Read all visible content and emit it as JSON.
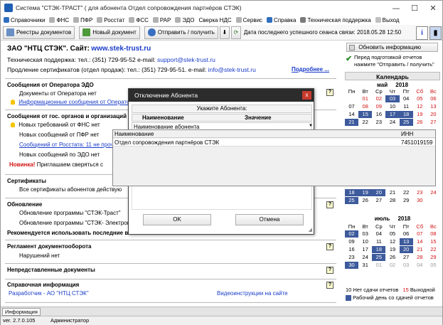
{
  "window": {
    "title": "Система \"СТЭК-ТРАСТ\" ( для абонента Отдел сопровождения партнёров СТЭК)",
    "minimize": "—",
    "maximize": "☐",
    "close": "✕"
  },
  "menu": [
    {
      "label": "Справочники",
      "icon": "book-icon",
      "color": "#2f6fc0"
    },
    {
      "label": "ФНС",
      "icon": "fns-icon",
      "color": "#b0b0b0"
    },
    {
      "label": "ПФР",
      "icon": "pfr-icon",
      "color": "#b0b0b0"
    },
    {
      "label": "Росстат",
      "icon": "rosstat-icon",
      "color": "#b0b0b0"
    },
    {
      "label": "ФСС",
      "icon": "fss-icon",
      "color": "#b0b0b0"
    },
    {
      "label": "РАР",
      "icon": "rar-icon",
      "color": "#b0b0b0"
    },
    {
      "label": "ЭДО",
      "icon": "edo-icon",
      "color": "#b0b0b0"
    },
    {
      "label": "Сверка НДС",
      "icon": "",
      "color": ""
    },
    {
      "label": "Сервис",
      "icon": "service-icon",
      "color": "#b0b0b0"
    },
    {
      "label": "Справка",
      "icon": "help-book-icon",
      "color": "#2f6fc0"
    },
    {
      "label": "Техническая поддержка",
      "icon": "support-icon",
      "color": "#7a7a7a"
    },
    {
      "label": "Выход",
      "icon": "exit-icon",
      "color": "#c0c0c0"
    }
  ],
  "toolbar": {
    "registry": "Реестры документов",
    "new_doc": "Новый документ",
    "send": "Отправить / получить",
    "last_session_label": "Дата последнего успешного сеанса связи:",
    "last_session_value": "2018.05.28 12:50"
  },
  "header": {
    "company": "ЗАО \"НТЦ СТЭК\". Сайт:",
    "site": "www.stek-trust.ru",
    "support_label": "Техническая поддержка: тел.: (351) 729-95-52 e-mail:",
    "support_email": "support@stek-trust.ru",
    "sales_label": "Продление сертификатов (отдел продаж): тел.: (351) 729-95-51. e-mail:",
    "sales_email": "info@stek-trust.ru",
    "more": "Подробнее ..."
  },
  "sections": {
    "edo_title": "Сообщения от Оператора ЭДО",
    "edo_docs": "Документы от Оператора нет",
    "edo_info": "Информационные сообщения от Оператора: 1",
    "gov_title": "Сообщения от гос. органов и организаций",
    "fns": "Новых требований от ФНС нет",
    "pfr": "Новых сообщений от ПФР нет",
    "rosstat": "Сообщений от Росстата: 11 не прочитан",
    "edo": "Новых сообщений по ЭДО нет",
    "news_label": "Новинка!",
    "news_text": "Приглашаем сверяться с",
    "certs_title": "Сертификаты",
    "certs_text": "Все сертификаты абонентов действую",
    "upd_title": "Обновление",
    "upd1": "Обновление программы \"СТЭК-Траст\"",
    "upd2": "Обновление программы \"СТЭК- Электронная",
    "upd_rec": "Рекомендуется использовать последние ве",
    "reg_title": "Регламент документооборота",
    "reg_text": "Нарушений нет",
    "undoc_title": "Непредставленные документы",
    "ref_title": "Справочная информация",
    "ref_dev": "Разработчик - АО \"НТЦ СТЭК\"",
    "ref_video": "Видеоинструкции на сайте"
  },
  "right": {
    "upd_btn": "Обновить информацию",
    "hint1": "Перед подготовкой отчетов",
    "hint2": "нажмите \"Отправить / получить\"",
    "cal_title": "Календарь",
    "may_label": "май",
    "june_label": "июнь",
    "july_label": "июль",
    "year": "2018",
    "weekdays": [
      "Пн",
      "Вт",
      "Ср",
      "Чт",
      "Пт",
      "Сб",
      "Вс"
    ],
    "legend_n": "10",
    "legend_text": "Нет сдачи отчетов",
    "legend_holiday_n": "15",
    "legend_holiday": "Выходной",
    "legend_workday": "Рабочий день со сдачей отчетов"
  },
  "calendar": {
    "may": [
      [
        "",
        ""
      ],
      [
        "01",
        "r"
      ],
      [
        "02",
        "r"
      ],
      [
        "03",
        "b"
      ],
      [
        "04",
        ""
      ],
      [
        "05",
        "r"
      ],
      [
        "06",
        "r"
      ],
      [
        "07",
        ""
      ],
      [
        "08",
        "r"
      ],
      [
        "09",
        "r"
      ],
      [
        "10",
        ""
      ],
      [
        "11",
        ""
      ],
      [
        "12",
        "r"
      ],
      [
        "13",
        "r"
      ],
      [
        "14",
        ""
      ],
      [
        "15",
        "b"
      ],
      [
        "16",
        ""
      ],
      [
        "17",
        "b"
      ],
      [
        "18",
        "b"
      ],
      [
        "19",
        "r"
      ],
      [
        "20",
        "r"
      ],
      [
        "21",
        "b"
      ],
      [
        "22",
        ""
      ],
      [
        "23",
        ""
      ],
      [
        "24",
        ""
      ],
      [
        "25",
        "b"
      ],
      [
        "26",
        "r"
      ],
      [
        "27",
        "r"
      ]
    ],
    "june": [
      [
        "18",
        "b"
      ],
      [
        "19",
        "b"
      ],
      [
        "20",
        "b"
      ],
      [
        "21",
        ""
      ],
      [
        "22",
        ""
      ],
      [
        "23",
        "r"
      ],
      [
        "24",
        "r"
      ],
      [
        "25",
        "b"
      ],
      [
        "26",
        ""
      ],
      [
        "27",
        ""
      ],
      [
        "28",
        ""
      ],
      [
        "29",
        ""
      ],
      [
        "30",
        "r"
      ],
      [
        "",
        ""
      ]
    ],
    "july": [
      [
        "02",
        "b"
      ],
      [
        "03",
        ""
      ],
      [
        "04",
        ""
      ],
      [
        "05",
        ""
      ],
      [
        "06",
        ""
      ],
      [
        "07",
        "r"
      ],
      [
        "08",
        "r"
      ],
      [
        "09",
        ""
      ],
      [
        "10",
        ""
      ],
      [
        "11",
        ""
      ],
      [
        "12",
        ""
      ],
      [
        "13",
        "b"
      ],
      [
        "14",
        "r"
      ],
      [
        "15",
        "r"
      ],
      [
        "16",
        ""
      ],
      [
        "17",
        ""
      ],
      [
        "18",
        "b"
      ],
      [
        "19",
        ""
      ],
      [
        "20",
        "b"
      ],
      [
        "21",
        "r"
      ],
      [
        "22",
        "r"
      ],
      [
        "23",
        ""
      ],
      [
        "24",
        ""
      ],
      [
        "25",
        "b"
      ],
      [
        "26",
        ""
      ],
      [
        "27",
        ""
      ],
      [
        "28",
        "r"
      ],
      [
        "29",
        "r"
      ],
      [
        "30",
        "b"
      ],
      [
        "31",
        ""
      ],
      [
        "01",
        "g"
      ],
      [
        "02",
        "g"
      ],
      [
        "03",
        "g"
      ],
      [
        "04",
        "g"
      ],
      [
        "05",
        "g"
      ]
    ]
  },
  "dialog": {
    "title": "Отключение Абонента",
    "close": "x",
    "prompt": "Укажите Абонента:",
    "col_name": "Наименование",
    "col_value": "Значение",
    "row_name": "Наименование абонента",
    "ok": "OK",
    "cancel": "Отмена"
  },
  "popup": {
    "col_name": "Наименование",
    "col_inn": "ИНН",
    "row_name": "Отдел сопровождения партнёров СТЭК",
    "row_inn": "7451019159"
  },
  "tabs": {
    "info": "Информация"
  },
  "status": {
    "version": "ver. 2.7.0.105",
    "user": "Администратор"
  }
}
